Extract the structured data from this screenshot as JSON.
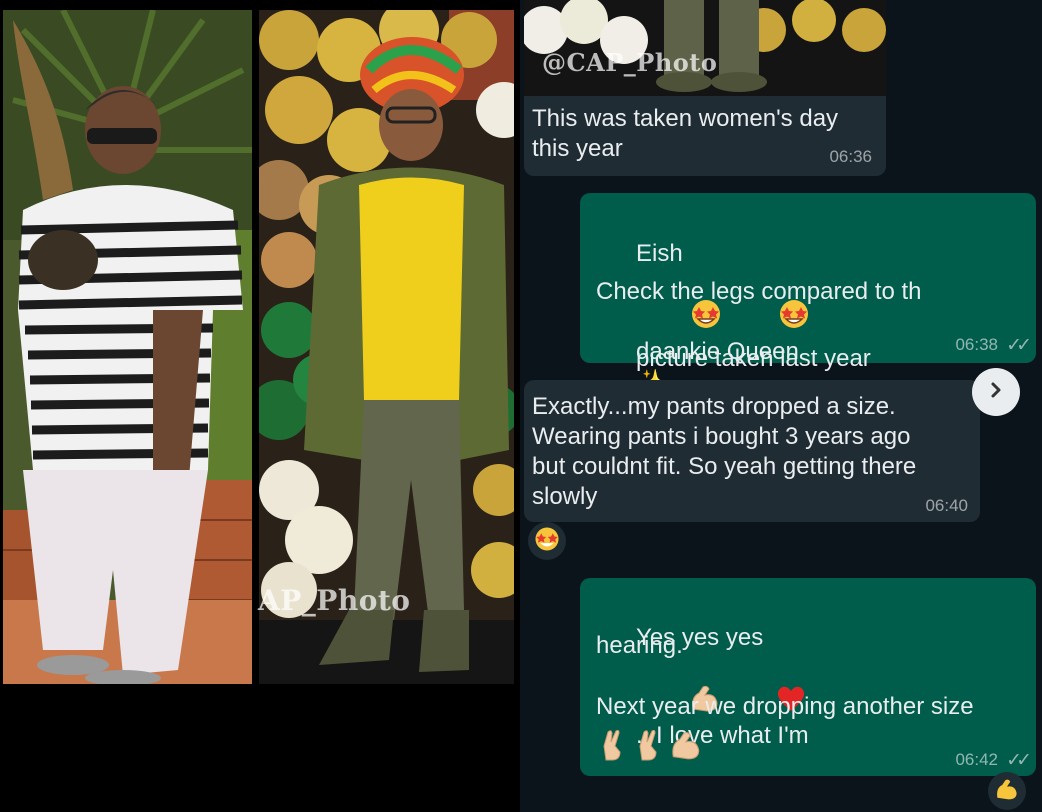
{
  "photos": {
    "watermark_bottom": "AP_Photo",
    "watermark_top": "@CAP_Photo"
  },
  "messages": [
    {
      "direction": "incoming",
      "text": "This was taken women's day\nthis year",
      "time": "06:36"
    },
    {
      "direction": "outgoing",
      "line1_a": "Eish",
      "line1_b": "daankie Queen",
      "line2": "Check the legs compared to th",
      "line3": "picture taken last year",
      "time": "06:38"
    },
    {
      "direction": "incoming",
      "text": "Exactly...my pants dropped a size.\nWearing pants i bought 3 years ago\nbut couldnt fit. So yeah getting there\nslowly",
      "time": "06:40"
    },
    {
      "direction": "outgoing",
      "line1_a": "Yes yes yes",
      "line1_b": ".. I love what I'm",
      "line2": "hearing.",
      "line3": "Next year we dropping another size",
      "time": "06:42"
    }
  ],
  "icons": {
    "next": "chevron-right-icon",
    "reaction_1": "star-struck-emoji",
    "reaction_2": "flexed-biceps-emoji",
    "read_receipt": "double-check-icon"
  },
  "colors": {
    "chat_bg": "#0b141a",
    "incoming_bubble": "#202c33",
    "outgoing_bubble": "#005c4b",
    "text": "#e9edef"
  }
}
